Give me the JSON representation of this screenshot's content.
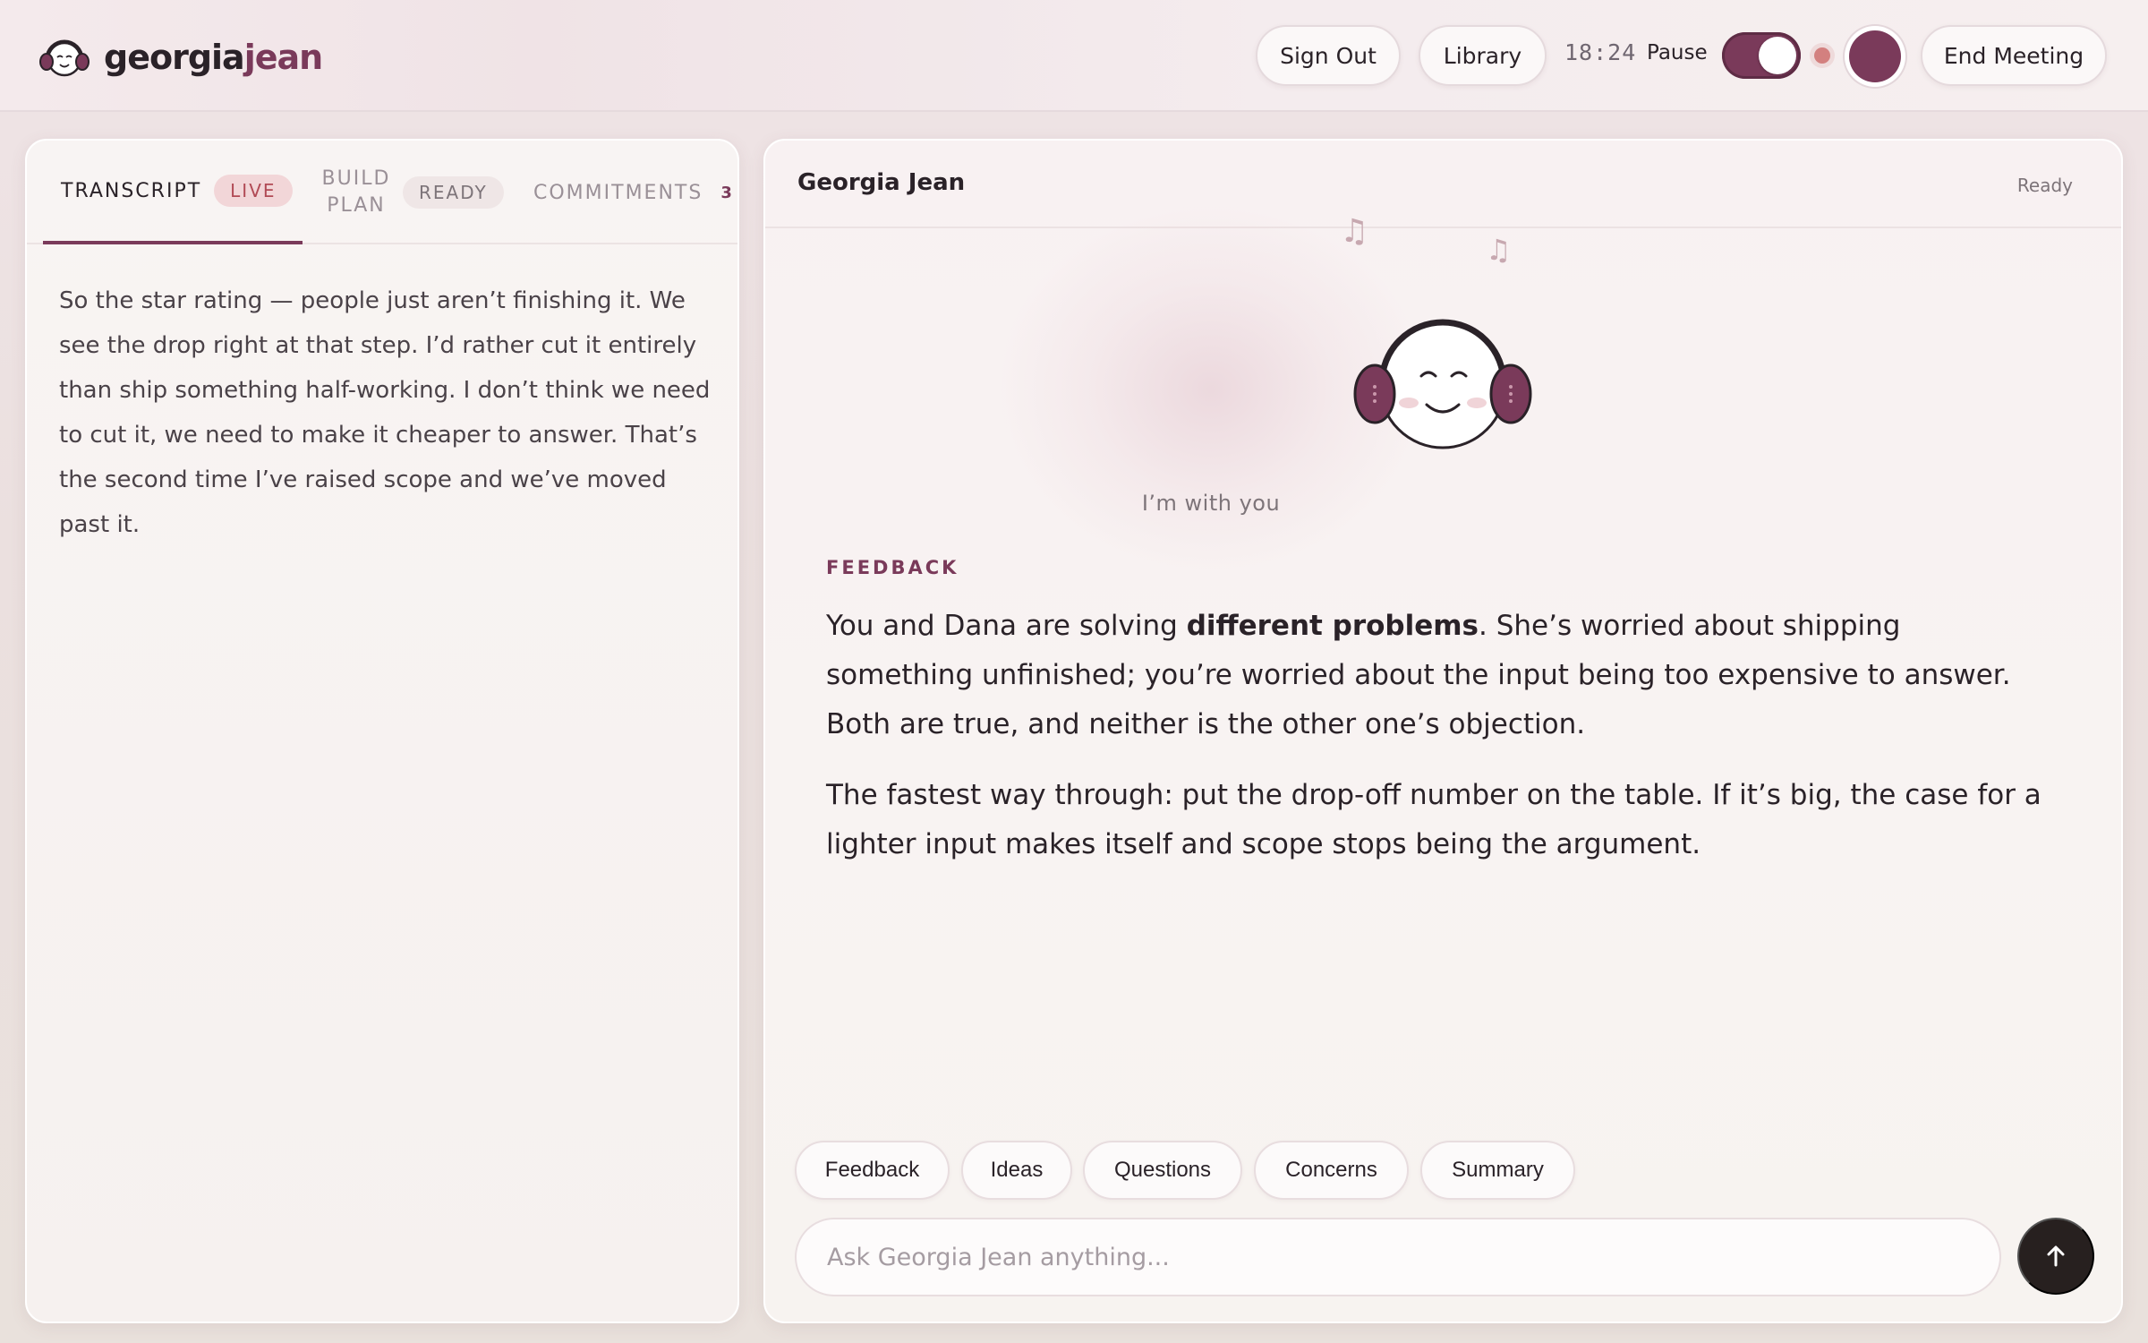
{
  "header": {
    "logo_part1": "georgia",
    "logo_part2": "jean",
    "sign_out": "Sign Out",
    "library": "Library",
    "timer": "18:24",
    "pause_label": "Pause",
    "end_meeting": "End Meeting"
  },
  "tabs": {
    "transcript": "TRANSCRIPT",
    "transcript_badge": "LIVE",
    "build_plan_line1": "BUILD",
    "build_plan_line2": "PLAN",
    "build_plan_badge": "READY",
    "commitments": "COMMITMENTS",
    "commitments_count": "3"
  },
  "transcript": {
    "text": "So the star rating — people just aren’t finishing it. We see the drop right at that step. I’d rather cut it entirely than ship something half-working. I don’t think we need to cut it, we need to make it cheaper to answer. That’s the second time I’ve raised scope and we’ve moved past it."
  },
  "assistant": {
    "name": "Georgia Jean",
    "status": "Ready",
    "caption": "I’m with you",
    "section_label": "FEEDBACK",
    "p1_before": "You and Dana are solving ",
    "p1_bold": "different problems",
    "p1_after": ". She’s worried about shipping something unfinished; you’re worried about the input being too expensive to answer. Both are true, and neither is the other one’s objection.",
    "p2": "The fastest way through: put the drop-off number on the table. If it’s big, the case for a lighter input makes itself and scope stops being the argument."
  },
  "chips": [
    "Feedback",
    "Ideas",
    "Questions",
    "Concerns",
    "Summary"
  ],
  "input": {
    "placeholder": "Ask Georgia Jean anything..."
  },
  "colors": {
    "brand": "#7a3a5a",
    "live_badge_text": "#b14a55",
    "send_button": "#27201f"
  },
  "icons": {
    "logo": "headphones-face-icon",
    "send": "arrow-up-icon",
    "notes": "music-note-icon"
  }
}
